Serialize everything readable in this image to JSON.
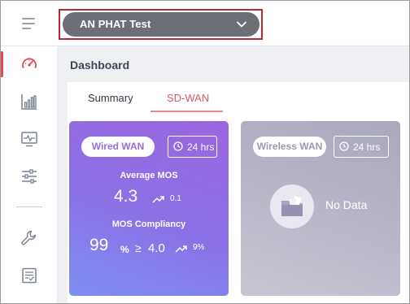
{
  "header": {
    "site_selector": {
      "value": "AN PHAT Test"
    }
  },
  "sidebar": {
    "items": [
      {
        "icon": "dashboard-gauge-icon",
        "active": true
      },
      {
        "icon": "bar-chart-icon"
      },
      {
        "icon": "monitor-pulse-icon"
      },
      {
        "icon": "sliders-icon"
      },
      {
        "icon": "wrench-icon"
      },
      {
        "icon": "checklist-report-icon"
      }
    ]
  },
  "page": {
    "title": "Dashboard"
  },
  "tabs": [
    {
      "label": "Summary",
      "active": false
    },
    {
      "label": "SD-WAN",
      "active": true
    }
  ],
  "cards": {
    "wired": {
      "label": "Wired WAN",
      "time_range": "24 hrs",
      "average_mos": {
        "label": "Average MOS",
        "value": "4.3",
        "delta": "0.1"
      },
      "mos_compliancy": {
        "label": "MOS Compliancy",
        "value": "99",
        "unit": "%",
        "comparator": "≥",
        "threshold": "4.0",
        "delta": "9%"
      }
    },
    "wireless": {
      "label": "Wireless WAN",
      "time_range": "24 hrs",
      "empty_text": "No Data"
    }
  },
  "colors": {
    "accent": "#dc5a66",
    "wired_card_top": "#9a66de",
    "wired_card_bottom": "#7f8ff2",
    "wireless_card": "#b9b8c9",
    "selector_bg": "#6c6f76",
    "highlight_outline": "#c0262e"
  }
}
